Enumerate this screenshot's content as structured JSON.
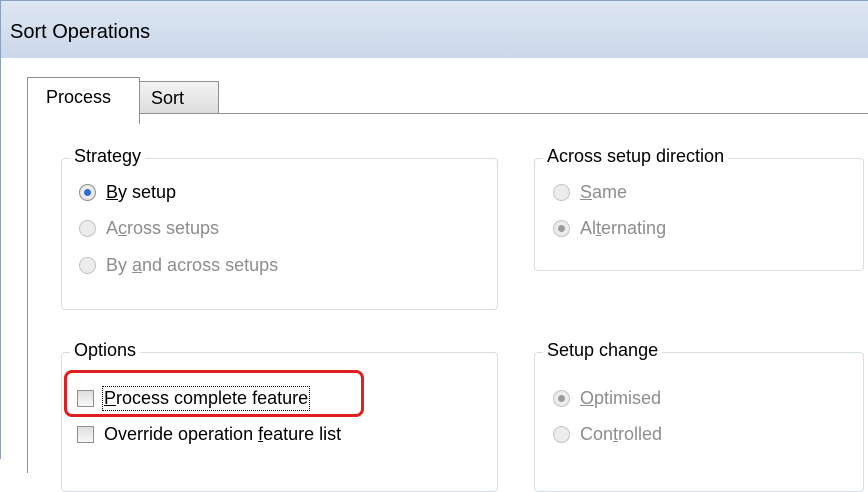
{
  "window": {
    "title": "Sort Operations"
  },
  "tabs": [
    {
      "label": "Process",
      "active": true
    },
    {
      "label": "Sort",
      "active": false
    }
  ],
  "strategy": {
    "label": "Strategy",
    "options": [
      {
        "pre": "",
        "key": "B",
        "post": "y setup",
        "checked": true,
        "enabled": true
      },
      {
        "pre": "A",
        "key": "c",
        "post": "ross setups",
        "checked": false,
        "enabled": false
      },
      {
        "pre": "By ",
        "key": "a",
        "post": "nd across setups",
        "checked": false,
        "enabled": false
      }
    ]
  },
  "across_setup_direction": {
    "label": "Across setup direction",
    "options": [
      {
        "pre": "",
        "key": "S",
        "post": "ame",
        "checked": false,
        "enabled": false
      },
      {
        "pre": "Al",
        "key": "t",
        "post": "ernating",
        "checked": true,
        "enabled": false
      }
    ]
  },
  "options_group": {
    "label": "Options",
    "items": [
      {
        "pre": "",
        "key": "P",
        "post": "rocess complete feature",
        "checked": false
      },
      {
        "pre": "Override operation ",
        "key": "f",
        "post": "eature list",
        "checked": false
      }
    ]
  },
  "setup_change": {
    "label": "Setup change",
    "options": [
      {
        "pre": "",
        "key": "O",
        "post": "ptimised",
        "checked": true,
        "enabled": false
      },
      {
        "pre": "Con",
        "key": "t",
        "post": "rolled",
        "checked": false,
        "enabled": false
      }
    ]
  },
  "colors": {
    "highlight": "#e02020",
    "titlebar": "#cbd8ea",
    "radio_selected": "#2f6bd6",
    "disabled_text": "#8d8d8d"
  }
}
